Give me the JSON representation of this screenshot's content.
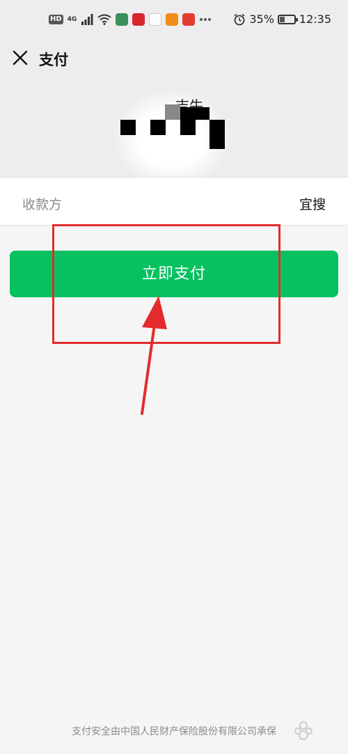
{
  "status_bar": {
    "hd_label": "HD",
    "network_label": "4G",
    "battery_percent_text": "35%",
    "battery_level": 0.35,
    "time": "12:35",
    "notification_icons": [
      "wifi-icon",
      "app-icon-1",
      "app-icon-2",
      "app-icon-3",
      "app-icon-4",
      "app-icon-5",
      "more-icon"
    ]
  },
  "header": {
    "title": "支付",
    "close_icon": "close-icon"
  },
  "merchant": {
    "name_partial": "吉牛"
  },
  "payee": {
    "label": "收款方",
    "value": "宜搜"
  },
  "pay_button": {
    "label": "立即支付",
    "color": "#07c160"
  },
  "footer": {
    "text": "支付安全由中国人民财产保险股份有限公司承保"
  },
  "annotation": {
    "color": "#e32b2b"
  }
}
